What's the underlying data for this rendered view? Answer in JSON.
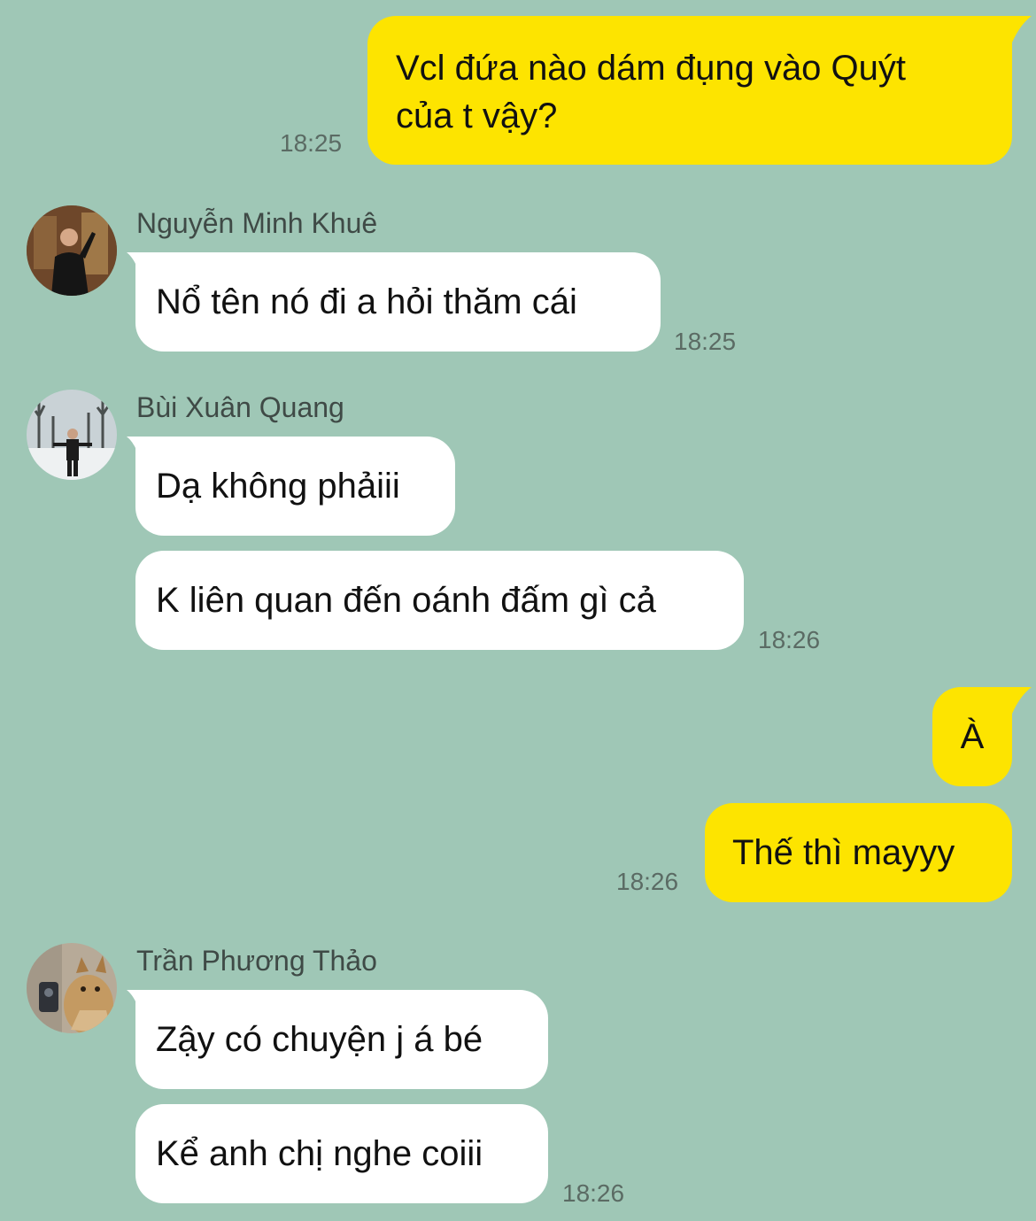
{
  "messages": [
    {
      "text_lines": [
        "Vcl đứa nào dám đụng vào Quýt",
        "của t vậy?"
      ],
      "time": "18:25"
    },
    {
      "sender": "Nguyễn Minh Khuê",
      "text": "Nổ tên nó đi a hỏi thăm cái",
      "time": "18:25"
    },
    {
      "sender": "Bùi Xuân Quang",
      "text": "Dạ không phảiii"
    },
    {
      "text": "K liên quan đến oánh đấm gì cả",
      "time": "18:26"
    },
    {
      "text": "À"
    },
    {
      "text": "Thế thì mayyy",
      "time": "18:26"
    },
    {
      "sender": "Trần Phương Thảo",
      "text": "Zậy có chuyện j á bé"
    },
    {
      "text": "Kể anh chị nghe coiii",
      "time": "18:26"
    }
  ],
  "colors": {
    "background": "#9fc7b6",
    "outgoing_bubble": "#fde400",
    "incoming_bubble": "#ffffff",
    "timestamp": "#5b6b64",
    "sender_name": "#3f4a46"
  }
}
